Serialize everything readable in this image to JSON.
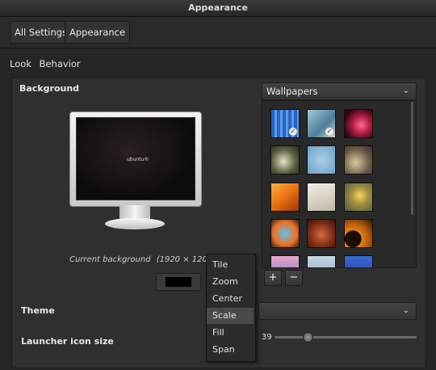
{
  "window": {
    "title": "Appearance"
  },
  "breadcrumbs": [
    {
      "label": "All Settings"
    },
    {
      "label": "Appearance"
    }
  ],
  "tabs": [
    {
      "label": "Look"
    },
    {
      "label": "Behavior"
    }
  ],
  "background": {
    "label": "Background",
    "current_caption": "Current background",
    "current_resolution": "(1920 × 1200)",
    "monitor_logo": "ubuntu®",
    "color_value": "#000000"
  },
  "wallpapers": {
    "source_selected": "Wallpapers",
    "thumbnails": [
      {
        "name": "blue-stripes-wallpaper",
        "selected": true
      },
      {
        "name": "tree-blue-wallpaper",
        "selected": true
      },
      {
        "name": "pink-spiral-wallpaper",
        "selected": false
      },
      {
        "name": "white-flowers-wallpaper",
        "selected": false
      },
      {
        "name": "birds-sky-wallpaper",
        "selected": false
      },
      {
        "name": "sepia-flowers-wallpaper",
        "selected": false
      },
      {
        "name": "orange-leaf-wallpaper",
        "selected": false
      },
      {
        "name": "paper-scraps-wallpaper",
        "selected": false
      },
      {
        "name": "yellow-flower-wallpaper",
        "selected": false
      },
      {
        "name": "cartoon-wallpaper",
        "selected": false
      },
      {
        "name": "red-bird-wallpaper",
        "selected": false
      },
      {
        "name": "orange-swirl-wallpaper",
        "selected": false
      }
    ],
    "add_label": "+",
    "remove_label": "−"
  },
  "placement_menu": {
    "items": [
      "Tile",
      "Zoom",
      "Center",
      "Scale",
      "Fill",
      "Span"
    ],
    "highlighted": "Scale"
  },
  "theme": {
    "label": "Theme",
    "value": ""
  },
  "launcher": {
    "label": "Launcher icon size",
    "value": "39",
    "slider_fraction": 0.2
  },
  "colors": {
    "accent": "#4a4a4a",
    "background": "#262626"
  }
}
